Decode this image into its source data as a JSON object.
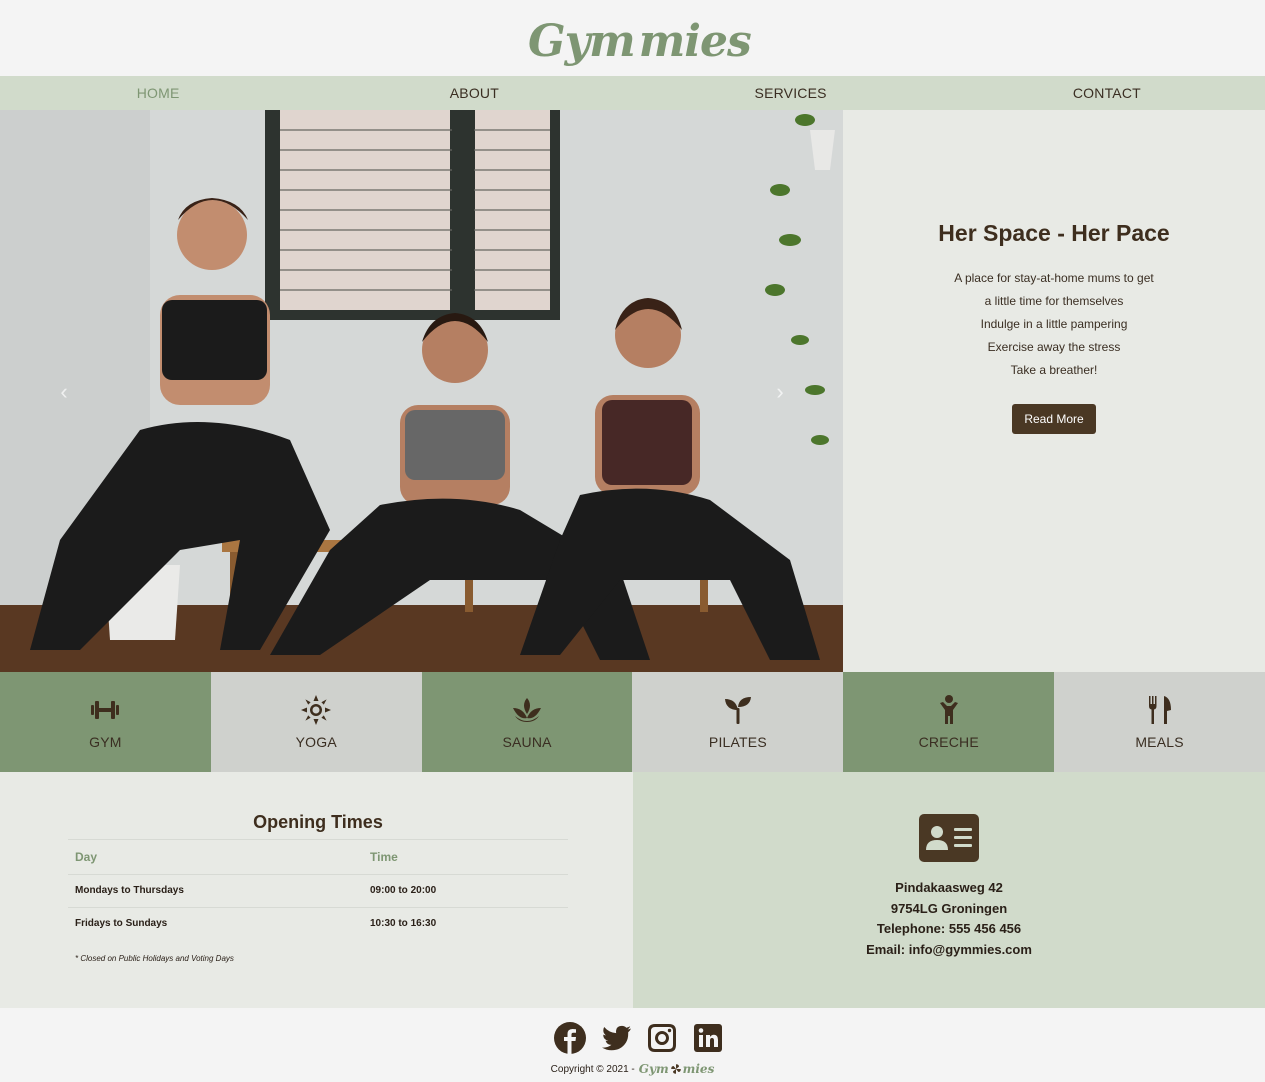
{
  "brand": {
    "logo_left": "Gym",
    "logo_right": "mies"
  },
  "nav": {
    "items": [
      {
        "label": "HOME"
      },
      {
        "label": "ABOUT"
      },
      {
        "label": "SERVICES"
      },
      {
        "label": "CONTACT"
      }
    ],
    "active": "HOME"
  },
  "hero": {
    "title": "Her Space - Her Pace",
    "lines": [
      "A place for stay-at-home mums to get",
      "a little time for themselves",
      "Indulge in a little pampering",
      "Exercise away the stress",
      "Take a breather!"
    ],
    "button": "Read More",
    "prev_icon": "‹",
    "next_icon": "›"
  },
  "services": [
    {
      "label": "GYM",
      "icon": "dumbbell-icon"
    },
    {
      "label": "YOGA",
      "icon": "sun-icon"
    },
    {
      "label": "SAUNA",
      "icon": "spa-icon"
    },
    {
      "label": "PILATES",
      "icon": "seedling-icon"
    },
    {
      "label": "CRECHE",
      "icon": "child-icon"
    },
    {
      "label": "MEALS",
      "icon": "utensils-icon"
    }
  ],
  "hours": {
    "title": "Opening Times",
    "columns": [
      "Day",
      "Time"
    ],
    "rows": [
      [
        "Mondays to Thursdays",
        "09:00 to 20:00"
      ],
      [
        "Fridays to Sundays",
        "10:30 to 16:30"
      ]
    ],
    "note": "* Closed on Public Holidays and Voting Days"
  },
  "contact": {
    "lines": [
      "Pindakaasweg 42",
      "9754LG Groningen",
      "Telephone: 555 456 456",
      "Email: info@gymmies.com"
    ]
  },
  "footer": {
    "social": [
      "facebook-icon",
      "twitter-icon",
      "instagram-icon",
      "linkedin-icon"
    ],
    "copyright": "Copyright © 2021 -",
    "logo_left": "Gym",
    "logo_right": "mies"
  },
  "colors": {
    "sage": "#7e9673",
    "sage_light": "#d1dbcb",
    "grey": "#cfd1cd",
    "brown": "#3e2e1e",
    "background": "#f4f4f4"
  }
}
